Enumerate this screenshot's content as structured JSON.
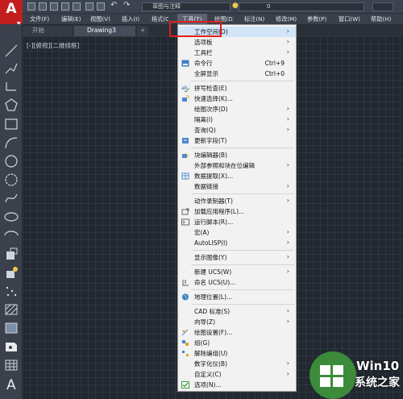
{
  "app": {
    "logo_letter": "A"
  },
  "quick_access": {
    "workspace": "草图与注释",
    "layer": "0"
  },
  "menubar": {
    "items": [
      {
        "label": "文件(F)"
      },
      {
        "label": "编辑(E)"
      },
      {
        "label": "视图(V)"
      },
      {
        "label": "插入(I)"
      },
      {
        "label": "格式(O)"
      },
      {
        "label": "工具(T)"
      },
      {
        "label": "绘图(D)"
      },
      {
        "label": "标注(N)"
      },
      {
        "label": "修改(M)"
      },
      {
        "label": "参数(P)"
      },
      {
        "label": "窗口(W)"
      },
      {
        "label": "帮助(H)"
      }
    ]
  },
  "tabs": [
    {
      "label": "开始"
    },
    {
      "label": "Drawing3"
    },
    {
      "label": "+"
    }
  ],
  "viewport": {
    "label": "[-][俯视][二维线框]"
  },
  "dropdown": {
    "items": [
      {
        "label": "工作空间(O)",
        "submenu": "›"
      },
      {
        "label": "选项板",
        "submenu": "›"
      },
      {
        "label": "工具栏",
        "submenu": "›"
      },
      {
        "label": "命令行",
        "shortcut": "Ctrl+9",
        "icon": "command-line-icon"
      },
      {
        "label": "全屏显示",
        "shortcut": "Ctrl+0"
      },
      {
        "label": "拼写检查(E)",
        "icon": "spell-check-icon"
      },
      {
        "label": "快速选择(K)...",
        "icon": "quick-select-icon"
      },
      {
        "label": "绘图次序(D)",
        "submenu": "›"
      },
      {
        "label": "隔离(I)",
        "submenu": "›"
      },
      {
        "label": "查询(Q)",
        "submenu": "›"
      },
      {
        "label": "更新字段(T)",
        "icon": "update-field-icon"
      },
      {
        "label": "块编辑器(B)",
        "icon": "block-editor-icon"
      },
      {
        "label": "外部参照和块在位编辑",
        "submenu": "›"
      },
      {
        "label": "数据提取(X)...",
        "icon": "data-extract-icon"
      },
      {
        "label": "数据链接",
        "submenu": "›"
      },
      {
        "label": "动作录制器(T)",
        "submenu": "›"
      },
      {
        "label": "加载应用程序(L)...",
        "icon": "load-app-icon"
      },
      {
        "label": "运行脚本(R)...",
        "icon": "run-script-icon"
      },
      {
        "label": "宏(A)",
        "submenu": "›"
      },
      {
        "label": "AutoLISP(I)",
        "submenu": "›"
      },
      {
        "label": "显示图像(Y)",
        "submenu": "›"
      },
      {
        "label": "新建 UCS(W)",
        "submenu": "›"
      },
      {
        "label": "命名 UCS(U)...",
        "icon": "named-ucs-icon"
      },
      {
        "label": "地理位置(L)...",
        "icon": "globe-icon"
      },
      {
        "label": "CAD 标准(S)",
        "submenu": "›"
      },
      {
        "label": "向导(Z)",
        "submenu": "›"
      },
      {
        "label": "绘图设置(F)...",
        "icon": "drafting-settings-icon"
      },
      {
        "label": "组(G)",
        "icon": "group-icon"
      },
      {
        "label": "解除编组(U)",
        "icon": "ungroup-icon"
      },
      {
        "label": "数字化仪(B)",
        "submenu": "›"
      },
      {
        "label": "自定义(C)",
        "submenu": "›"
      },
      {
        "label": "选项(N)...",
        "icon": "options-check-icon"
      }
    ]
  },
  "watermark": {
    "title": "Win10",
    "subtitle": "系统之家"
  },
  "colors": {
    "accent_red": "#e0201c",
    "logo_red": "#c31e1e",
    "watermark_green": "#3c8b3a"
  }
}
